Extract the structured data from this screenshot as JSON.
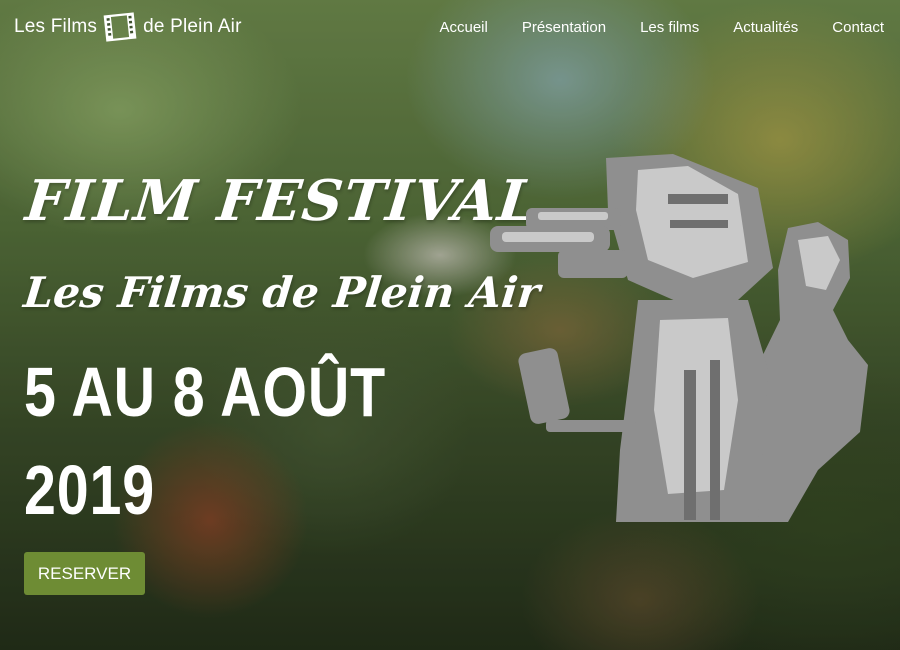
{
  "brand": {
    "name_left": "Les Films",
    "name_right": "de Plein Air",
    "icon": "film-strip-icon"
  },
  "nav": {
    "items": [
      "Accueil",
      "Présentation",
      "Les films",
      "Actualités",
      "Contact"
    ]
  },
  "hero": {
    "title": "FILM FESTIVAL",
    "subtitle": "Les Films de Plein Air",
    "dates_line1": "5 AU 8 AOÛT",
    "dates_line2": "2019",
    "cta_label": "RESERVER",
    "illustration": "cameraman-illustration"
  },
  "colors": {
    "cta": "#6e8c34",
    "text": "#ffffff",
    "illustration": "#8c8c8c"
  }
}
